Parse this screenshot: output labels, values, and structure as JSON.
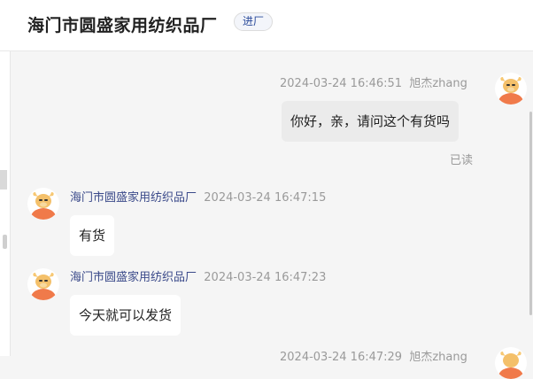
{
  "header": {
    "title": "海门市圆盛家用纺织品厂",
    "badge": "进厂"
  },
  "messages": [
    {
      "time": "2024-03-24 16:46:51",
      "sender": "旭杰zhang",
      "text": "你好，亲，请问这个有货吗",
      "status": "已读"
    },
    {
      "sender": "海门市圆盛家用纺织品厂",
      "time": "2024-03-24 16:47:15",
      "text": "有货"
    },
    {
      "sender": "海门市圆盛家用纺织品厂",
      "time": "2024-03-24 16:47:23",
      "text": "今天就可以发货"
    },
    {
      "time": "2024-03-24 16:47:29",
      "sender": "旭杰zhang"
    }
  ],
  "icons": {
    "avatar": "cartoon-ox-avatar-icon"
  },
  "colors": {
    "accent_orange": "#f07a4a",
    "badge_text": "#2a4a9a",
    "shop_name": "#3b4a8a"
  }
}
